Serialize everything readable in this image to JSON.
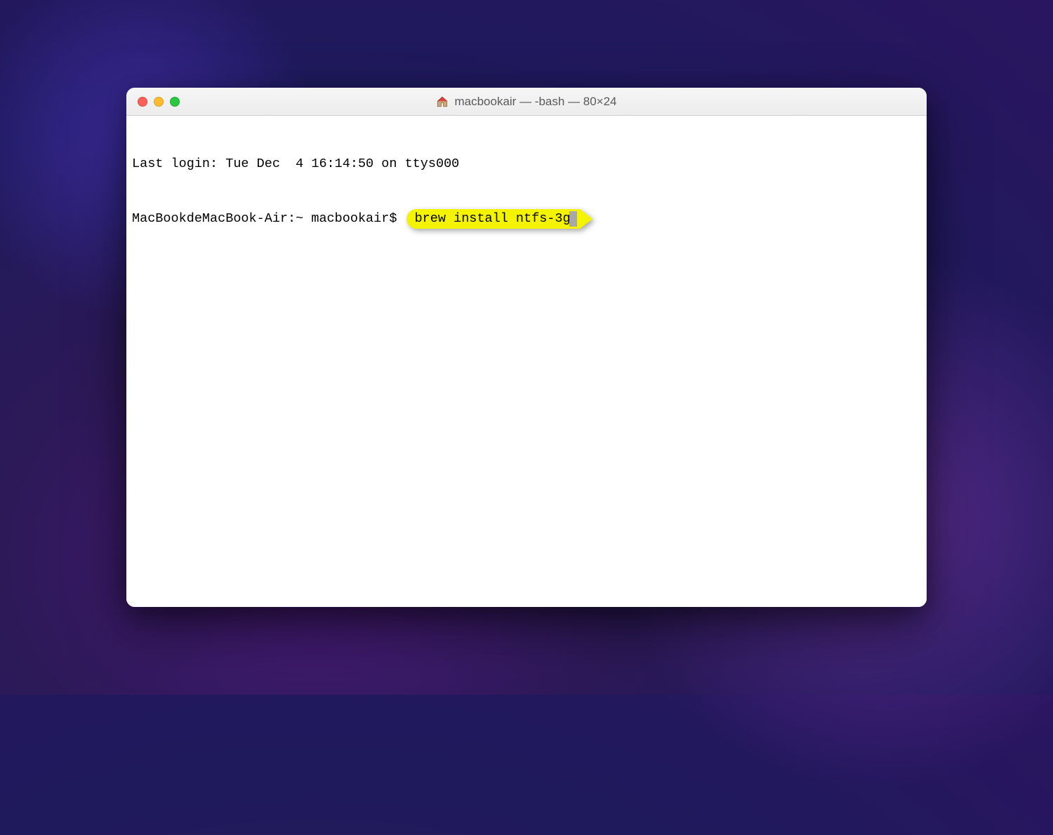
{
  "window": {
    "title": "macbookair — -bash — 80×24",
    "icon": "home-icon"
  },
  "terminal": {
    "last_login": "Last login: Tue Dec  4 16:14:50 on ttys000",
    "prompt": "MacBookdeMacBook-Air:~ macbookair$ ",
    "command": "brew install ntfs-3g"
  },
  "colors": {
    "close": "#ff5f57",
    "minimize": "#febc2e",
    "maximize": "#28c840",
    "highlight": "#f4f400"
  }
}
